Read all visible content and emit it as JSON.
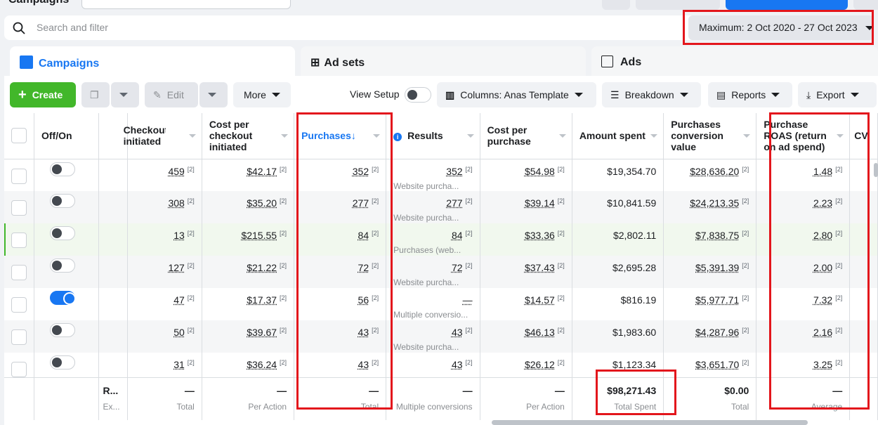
{
  "topbar": {
    "title": "Campaigns"
  },
  "search": {
    "placeholder": "Search and filter"
  },
  "date_range": "Maximum: 2 Oct 2020 - 27 Oct 2023",
  "tabs": [
    {
      "label": "Campaigns",
      "active": true
    },
    {
      "label": "Ad sets"
    },
    {
      "label": "Ads"
    }
  ],
  "toolbar": {
    "create": "Create",
    "edit": "Edit",
    "more": "More",
    "view_setup": "View Setup",
    "columns": "Columns: Anas Template",
    "breakdown": "Breakdown",
    "reports": "Reports",
    "export": "Export"
  },
  "colors": {
    "accent": "#1877f2",
    "create": "#42b72a",
    "highlight": "#e3161c"
  },
  "columns": [
    "Off/On",
    "Checkouts initiated",
    "Cost per checkout initiated",
    "Purchases",
    "Results",
    "Cost per purchase",
    "Amount spent",
    "Purchases conversion value",
    "Purchase ROAS (return on ad spend)",
    "CV"
  ],
  "rows": [
    {
      "on": false,
      "checkouts": "459",
      "cpc": "$42.17",
      "purchases": "352",
      "results": "352",
      "results_sub": "Website purcha...",
      "cpp": "$54.98",
      "spent": "$19,354.70",
      "value": "$28,636.20",
      "roas": "1.48"
    },
    {
      "on": false,
      "checkouts": "308",
      "cpc": "$35.20",
      "purchases": "277",
      "results": "277",
      "results_sub": "Website purcha...",
      "cpp": "$39.14",
      "spent": "$10,841.59",
      "value": "$24,213.35",
      "roas": "2.23"
    },
    {
      "on": false,
      "checkouts": "13",
      "cpc": "$215.55",
      "purchases": "84",
      "results": "84",
      "results_sub": "Purchases (web...",
      "cpp": "$33.36",
      "spent": "$2,802.11",
      "value": "$7,838.75",
      "roas": "2.80"
    },
    {
      "on": false,
      "checkouts": "127",
      "cpc": "$21.22",
      "purchases": "72",
      "results": "72",
      "results_sub": "Website purcha...",
      "cpp": "$37.43",
      "spent": "$2,695.28",
      "value": "$5,391.39",
      "roas": "2.00"
    },
    {
      "on": true,
      "checkouts": "47",
      "cpc": "$17.37",
      "purchases": "56",
      "results": "—",
      "results_sub": "Multiple conversio...",
      "cpp": "$14.57",
      "spent": "$816.19",
      "value": "$5,977.71",
      "roas": "7.32"
    },
    {
      "on": false,
      "checkouts": "50",
      "cpc": "$39.67",
      "purchases": "43",
      "results": "43",
      "results_sub": "Website purcha...",
      "cpp": "$46.13",
      "spent": "$1,983.60",
      "value": "$4,287.96",
      "roas": "2.16"
    },
    {
      "on": false,
      "checkouts": "31",
      "cpc": "$36.24",
      "purchases": "43",
      "results": "43",
      "results_sub": "",
      "cpp": "$26.12",
      "spent": "$1,123.34",
      "value": "$3,651.70",
      "roas": "3.25"
    }
  ],
  "ref": "[2]",
  "footer": {
    "name": "R...",
    "name_sub": "Ex...",
    "checkouts": "—",
    "checkouts_sub": "Total",
    "cpc": "—",
    "cpc_sub": "Per Action",
    "purchases": "—",
    "purchases_sub": "Total",
    "results": "—",
    "results_sub": "Multiple conversions",
    "cpp": "—",
    "cpp_sub": "Per Action",
    "spent": "$98,271.43",
    "spent_sub": "Total Spent",
    "value": "$0.00",
    "value_sub": "Total",
    "roas": "—",
    "roas_sub": "Average"
  }
}
